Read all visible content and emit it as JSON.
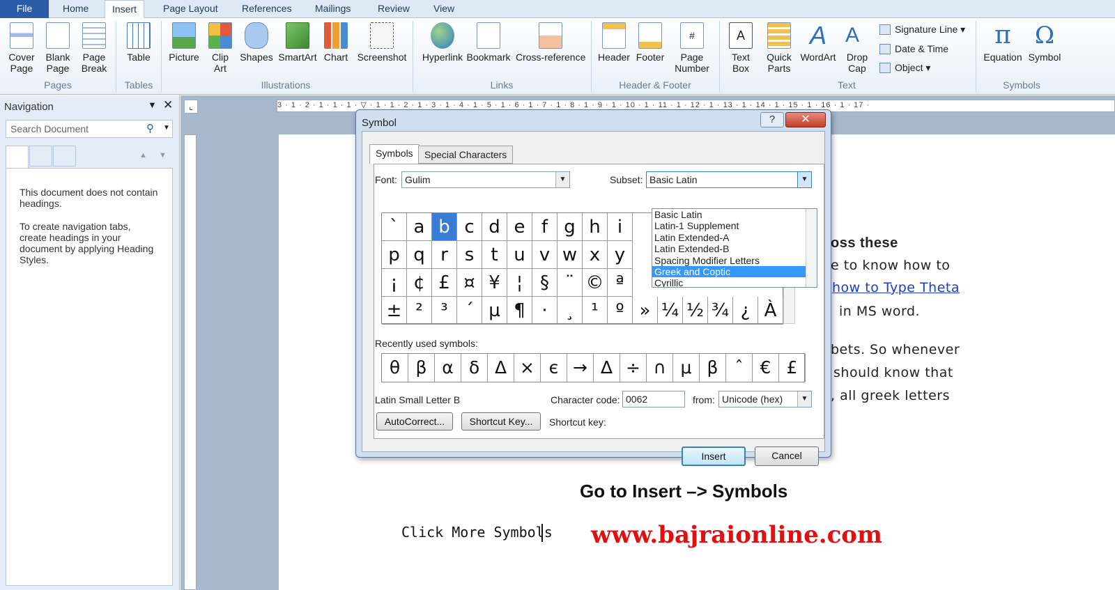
{
  "tabs": [
    "File",
    "Home",
    "Insert",
    "Page Layout",
    "References",
    "Mailings",
    "Review",
    "View"
  ],
  "ribbon": {
    "pages": {
      "cover_page": "Cover\nPage",
      "blank_page": "Blank\nPage",
      "page_break": "Page\nBreak",
      "group": "Pages"
    },
    "tables": {
      "table": "Table",
      "group": "Tables"
    },
    "illustrations": {
      "picture": "Picture",
      "clip_art": "Clip\nArt",
      "shapes": "Shapes",
      "smartart": "SmartArt",
      "chart": "Chart",
      "screenshot": "Screenshot",
      "group": "Illustrations"
    },
    "links": {
      "hyperlink": "Hyperlink",
      "bookmark": "Bookmark",
      "cross_reference": "Cross-reference",
      "group": "Links"
    },
    "header_footer": {
      "header": "Header",
      "footer": "Footer",
      "page_number": "Page\nNumber",
      "group": "Header & Footer"
    },
    "text": {
      "text_box": "Text\nBox",
      "quick_parts": "Quick\nParts",
      "wordart": "WordArt",
      "drop_cap": "Drop\nCap",
      "signature_line": "Signature Line",
      "date_time": "Date & Time",
      "object": "Object",
      "group": "Text"
    },
    "symbols": {
      "equation": "Equation",
      "symbol": "Symbol",
      "group": "Symbols"
    }
  },
  "nav": {
    "title": "Navigation",
    "search_placeholder": "Search Document",
    "msg1": "This document does not contain headings.",
    "msg2": "To create navigation tabs, create headings in your document by applying Heading Styles."
  },
  "ruler_text": "3 · 1 · 2 · 1 · 1 · 1 · ▽ · 1 · 1 · 2 · 1 · 3 · 1 · 4 · 1 · 5 · 1 · 6 · 1 · 7 · 1 · 8 · 1 · 9 · 1 · 10 · 1 · 11 · 1 · 12 · 1 · 13 · 1 · 14 · 1 · 15 · 1 · 16 · 1 · 17 ·",
  "document": {
    "line1": "oss these",
    "line2": "e  to know  how  to",
    "link": "how  to  Type  Theta",
    "line3": "in  MS  word.",
    "line4": "bets.  So  whenever",
    "line5": "should  know  that",
    "line6": ",  all  greek  letters",
    "heading": "Go to Insert –> Symbols",
    "click_more": "Click More Symbols",
    "website": "www.bajraionline.com"
  },
  "dialog": {
    "title": "Symbol",
    "help": "?",
    "close": "✕",
    "tab_symbols": "Symbols",
    "tab_special": "Special Characters",
    "font_label": "Font:",
    "font_value": "Gulim",
    "subset_label": "Subset:",
    "subset_value": "Basic Latin",
    "subset_options": [
      "Basic Latin",
      "Latin-1 Supplement",
      "Latin Extended-A",
      "Latin Extended-B",
      "Spacing Modifier Letters",
      "Greek and Coptic",
      "Cyrillic"
    ],
    "subset_selected": "Greek and Coptic",
    "grid_rows": [
      [
        "`",
        "a",
        "b",
        "c",
        "d",
        "e",
        "f",
        "g",
        "h",
        "i"
      ],
      [
        "p",
        "q",
        "r",
        "s",
        "t",
        "u",
        "v",
        "w",
        "x",
        "y"
      ],
      [
        "¡",
        "¢",
        "£",
        "¤",
        "¥",
        "¦",
        "§",
        "¨",
        "©",
        "ª"
      ],
      [
        "±",
        "²",
        "³",
        "´",
        "µ",
        "¶",
        "·",
        "¸",
        "¹",
        "º",
        "»",
        "¼",
        "½",
        "¾",
        "¿",
        "À"
      ]
    ],
    "selected_char": "b",
    "recent_label": "Recently used symbols:",
    "recent": [
      "θ",
      "β",
      "α",
      "δ",
      "Δ",
      "×",
      "є",
      "→",
      "∆",
      "÷",
      "∩",
      "μ",
      "β",
      "ˆ",
      "€",
      "£"
    ],
    "char_name": "Latin Small Letter B",
    "code_label": "Character code:",
    "code_value": "0062",
    "from_label": "from:",
    "from_value": "Unicode (hex)",
    "autocorrect": "AutoCorrect...",
    "shortcut_key_btn": "Shortcut Key...",
    "shortcut_key_label": "Shortcut key:",
    "insert": "Insert",
    "cancel": "Cancel"
  },
  "colors": {
    "accent": "#2a5ca8",
    "selection": "#3399ff",
    "website": "#e01010",
    "link": "#1a3ccf"
  }
}
